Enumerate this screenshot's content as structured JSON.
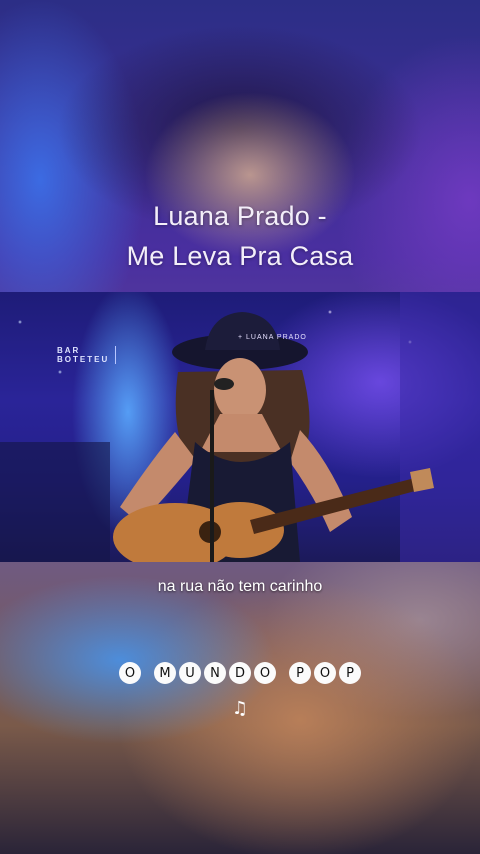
{
  "title": {
    "line1": "Luana Prado -",
    "line2": "Me Leva Pra Casa"
  },
  "video": {
    "venue_logo_line1": "BAR",
    "venue_logo_line2": "BOTETEU",
    "watermark": "+ LUANA PRADO"
  },
  "caption": "na rua não tem carinho",
  "brand": {
    "letters": [
      "O",
      "M",
      "U",
      "N",
      "D",
      "O",
      "P",
      "O",
      "P"
    ]
  },
  "music_note": "♫"
}
